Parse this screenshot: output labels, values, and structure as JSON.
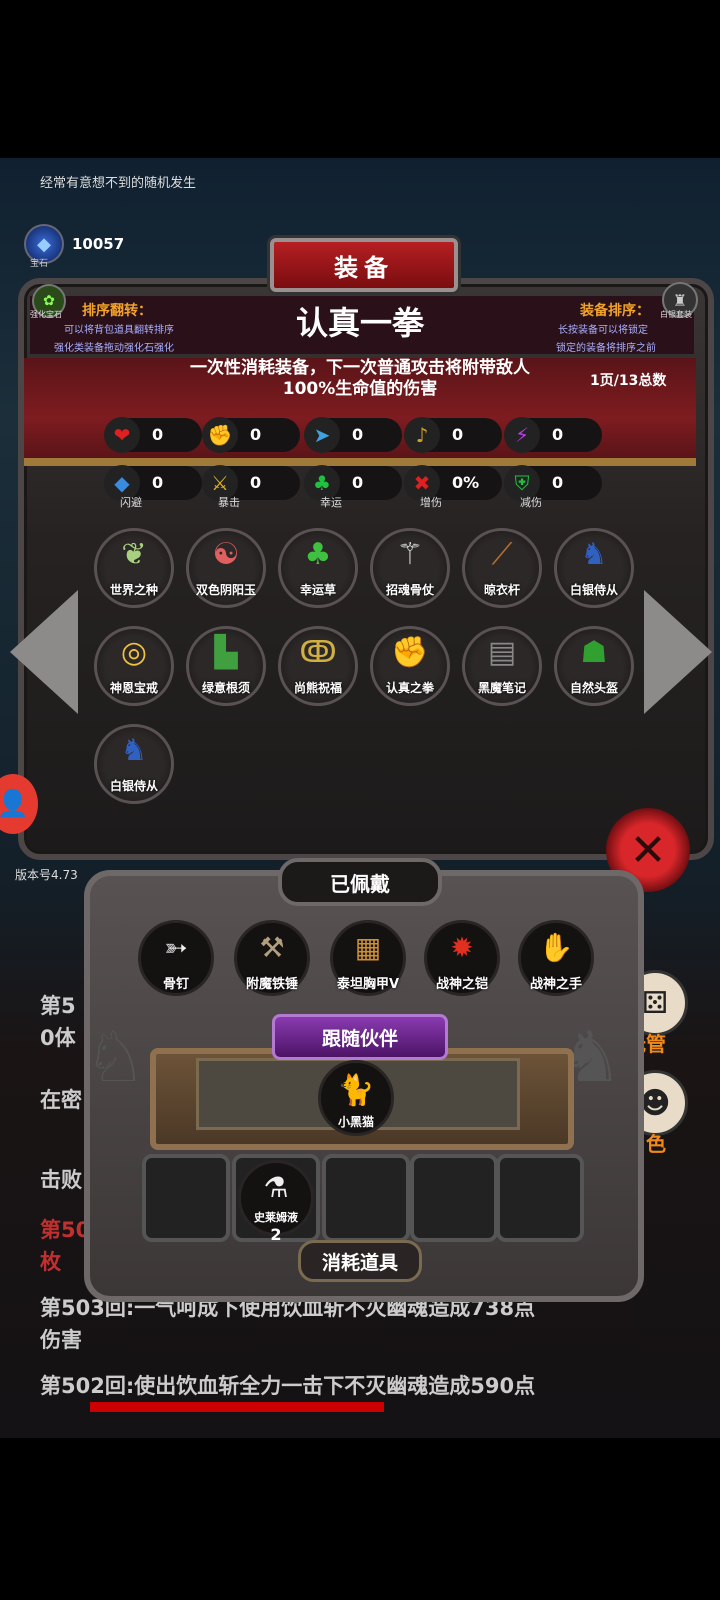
{
  "tip": "经常有意想不到的随机发生",
  "gem": {
    "count": "10057",
    "label": "宝石"
  },
  "panel": {
    "title": "装备",
    "sort_left_title": "排序翻转：",
    "sort_left_line1": "可以将背包道具翻转排序",
    "sort_left_line2": "强化类装备拖动强化石强化",
    "sort_right_title": "装备排序：",
    "sort_right_line1": "长按装备可以将锁定",
    "sort_right_line2": "锁定的装备将排序之前",
    "left_icon_label": "强化宝石",
    "right_icon_label": "白银套装",
    "item_name": "认真一拳",
    "description": "一次性消耗装备，下一次普通攻击将附带敌人100%生命值的伤害",
    "page": "1页/13总数"
  },
  "stats": [
    {
      "icon": "heart-icon",
      "glyph": "❤",
      "color": "#e02020",
      "value": "0",
      "label": ""
    },
    {
      "icon": "strength-icon",
      "glyph": "✊",
      "color": "#e0b020",
      "value": "0",
      "label": ""
    },
    {
      "icon": "speed-icon",
      "glyph": "➤",
      "color": "#40a0e0",
      "value": "0",
      "label": ""
    },
    {
      "icon": "harp-icon",
      "glyph": "♪",
      "color": "#d0a020",
      "value": "0",
      "label": ""
    },
    {
      "icon": "lightning-icon",
      "glyph": "⚡",
      "color": "#b040e0",
      "value": "0",
      "label": ""
    },
    {
      "icon": "dodge-icon",
      "glyph": "◆",
      "color": "#3a8ae0",
      "value": "0",
      "label": "闪避"
    },
    {
      "icon": "crit-icon",
      "glyph": "⚔",
      "color": "#e0b020",
      "value": "0",
      "label": "暴击"
    },
    {
      "icon": "clover-icon",
      "glyph": "♣",
      "color": "#20c040",
      "value": "0",
      "label": "幸运"
    },
    {
      "icon": "swords-icon",
      "glyph": "✖",
      "color": "#e02020",
      "value": "0%",
      "label": "增伤"
    },
    {
      "icon": "shield-icon",
      "glyph": "⛨",
      "color": "#20c040",
      "value": "0",
      "label": "减伤"
    }
  ],
  "inventory": [
    {
      "name": "世界之种",
      "icon": "seed-icon",
      "glyph": "❦",
      "color": "#a8d080"
    },
    {
      "name": "双色阴阳玉",
      "icon": "yinyang-icon",
      "glyph": "☯",
      "color": "#e06060"
    },
    {
      "name": "幸运草",
      "icon": "clover-icon",
      "glyph": "♣",
      "color": "#40c040"
    },
    {
      "name": "招魂骨仗",
      "icon": "staff-icon",
      "glyph": "⚚",
      "color": "#e0e0e0"
    },
    {
      "name": "晾衣杆",
      "icon": "stick-icon",
      "glyph": "⟋",
      "color": "#b07030"
    },
    {
      "name": "白银侍从",
      "icon": "knight-icon",
      "glyph": "♞",
      "color": "#3060c0"
    },
    {
      "name": "神恩宝戒",
      "icon": "ring-icon",
      "glyph": "◎",
      "color": "#f0c040"
    },
    {
      "name": "绿意根须",
      "icon": "boots-icon",
      "glyph": "▙",
      "color": "#40a040"
    },
    {
      "name": "尚熊祝福",
      "icon": "necklace-icon",
      "glyph": "ↂ",
      "color": "#d0b040"
    },
    {
      "name": "认真之拳",
      "icon": "fist-icon",
      "glyph": "✊",
      "color": "#f0c0a0"
    },
    {
      "name": "黑魔笔记",
      "icon": "book-icon",
      "glyph": "▤",
      "color": "#888"
    },
    {
      "name": "自然头盔",
      "icon": "helmet-icon",
      "glyph": "☗",
      "color": "#30a030"
    },
    {
      "name": "白银侍从",
      "icon": "knight-icon",
      "glyph": "♞",
      "color": "#3060c0"
    }
  ],
  "version": "版本号4.73",
  "log": {
    "line1": "第5",
    "line2": "0体",
    "line3": "在密",
    "line4": "击败",
    "line5": "第50",
    "line6": "枚",
    "line7": "第503回:一气呵成下使用饮血斩不灭幽魂造成738点",
    "line8": "伤害",
    "line9": "第502回:使出饮血斩全力一击下不灭幽魂造成590点"
  },
  "equipped": {
    "title": "已佩戴",
    "items": [
      {
        "name": "骨钉",
        "icon": "bone-nail-icon",
        "glyph": "➳",
        "color": "#eee"
      },
      {
        "name": "附魔铁锤",
        "icon": "hammer-icon",
        "glyph": "⚒",
        "color": "#b0a080"
      },
      {
        "name": "泰坦胸甲V",
        "icon": "armor-icon",
        "glyph": "▦",
        "color": "#d09030"
      },
      {
        "name": "战神之铠",
        "icon": "war-armor-icon",
        "glyph": "✹",
        "color": "#e03020"
      },
      {
        "name": "战神之手",
        "icon": "gauntlet-icon",
        "glyph": "✋",
        "color": "#70a0d0"
      }
    ]
  },
  "companion": {
    "title": "跟随伙伴",
    "name": "小黑猫",
    "icon": "cat-icon",
    "glyph": "🐈"
  },
  "consumables": {
    "title": "消耗道具",
    "item_name": "史莱姆液",
    "count": "2"
  },
  "side": {
    "auto_label": "托管",
    "role_label": "角色"
  }
}
